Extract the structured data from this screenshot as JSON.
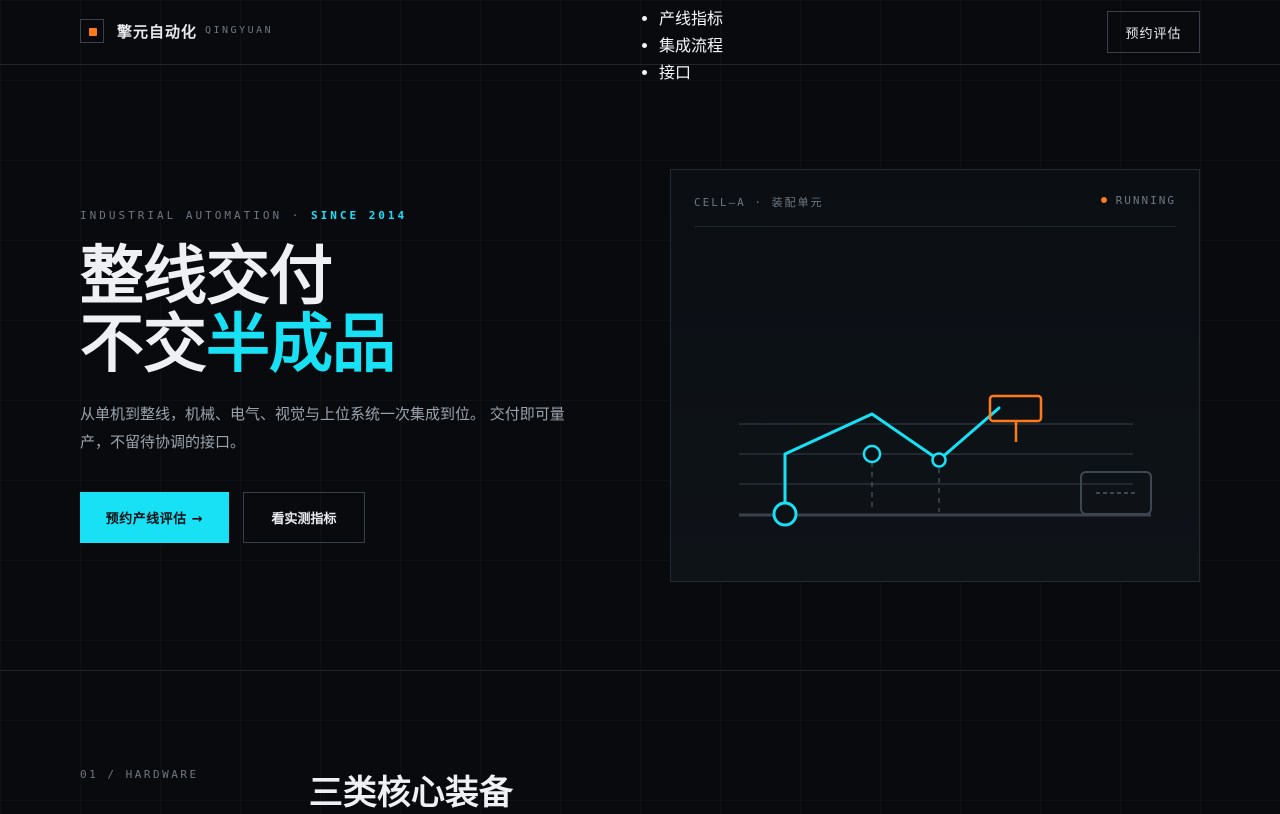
{
  "header": {
    "brand": "擎元自动化",
    "brand_en": "QINGYUAN",
    "nav": [
      "产线指标",
      "集成流程",
      "接口"
    ],
    "cta": "预约评估"
  },
  "hero": {
    "eyebrow_prefix": "INDUSTRIAL AUTOMATION · ",
    "eyebrow_highlight": "SINCE 2014",
    "title_line1": "整线交付",
    "title_line2_plain": "不交",
    "title_line2_accent": "半成品",
    "lead": "从单机到整线，机械、电气、视觉与上位系统一次集成到位。 交付即可量产，不留待协调的接口。",
    "primary_button": "预约产线评估 →",
    "secondary_button": "看实测指标"
  },
  "panel": {
    "label": "CELL—A · 装配单元",
    "status": "RUNNING"
  },
  "section": {
    "number": "01 / HARDWARE",
    "title": "三类核心装备"
  },
  "colors": {
    "accent": "#18e0f5",
    "warning": "#ff7a1a",
    "background": "#080a0d"
  }
}
